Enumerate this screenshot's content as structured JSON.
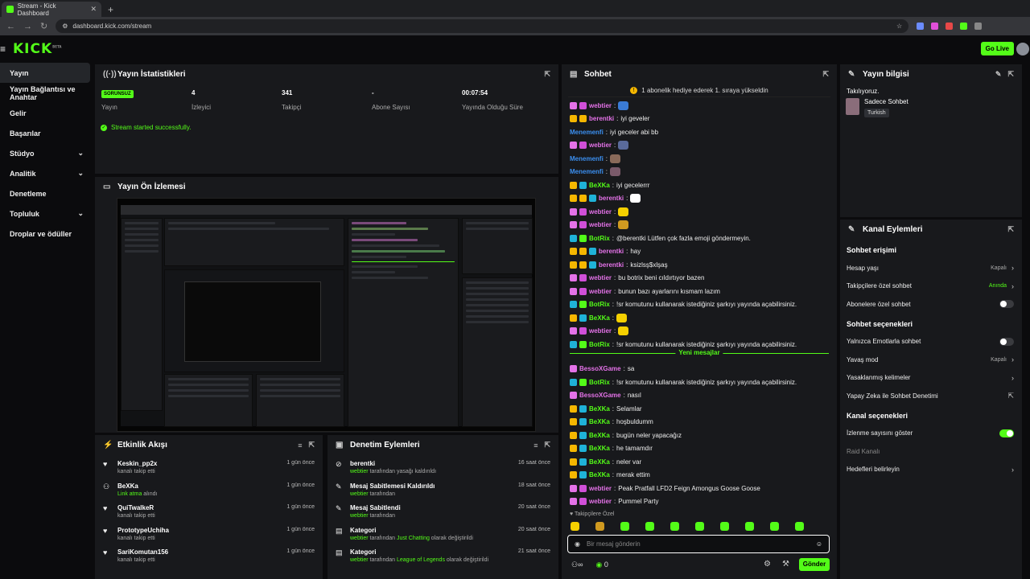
{
  "browser": {
    "tab_title": "Stream - Kick Dashboard",
    "tab_close": "✕",
    "new_tab": "+",
    "url": "dashboard.kick.com/stream"
  },
  "app": {
    "logo": "KICK",
    "logo_sup": "BETA",
    "go_live": "Go Live"
  },
  "sidebar": {
    "items": [
      {
        "label": "Yayın",
        "chevron": ""
      },
      {
        "label": "Yayın Bağlantısı ve Anahtar",
        "chevron": ""
      },
      {
        "label": "Gelir",
        "chevron": ""
      },
      {
        "label": "Başarılar",
        "chevron": ""
      },
      {
        "label": "Stüdyo",
        "chevron": "⌄"
      },
      {
        "label": "Analitik",
        "chevron": "⌄"
      },
      {
        "label": "Denetleme",
        "chevron": ""
      },
      {
        "label": "Topluluk",
        "chevron": "⌄"
      },
      {
        "label": "Droplar ve ödüller",
        "chevron": ""
      }
    ]
  },
  "stats_panel": {
    "title": "Yayın İstatistikleri",
    "items": [
      {
        "value": "SORUNSUZ",
        "label": "Yayın"
      },
      {
        "value": "4",
        "label": "İzleyici"
      },
      {
        "value": "341",
        "label": "Takipçi"
      },
      {
        "value": "-",
        "label": "Abone Sayısı"
      },
      {
        "value": "00:07:54",
        "label": "Yayında Olduğu Süre"
      }
    ],
    "success_msg": "Stream started successfully."
  },
  "preview_panel": {
    "title": "Yayın Ön İzlemesi"
  },
  "activity_panel": {
    "title": "Etkinlik Akışı",
    "items": [
      {
        "name": "Keskin_pp2x",
        "desc": "kanalı takip etti",
        "time": "1 gün önce",
        "icon": "♥"
      },
      {
        "name": "BeXKa",
        "desc": "Link atma",
        "desc2": " alındı",
        "time": "1 gün önce",
        "icon": "⚇"
      },
      {
        "name": "QuiTwalkeR",
        "desc": "kanalı takip etti",
        "time": "1 gün önce",
        "icon": "♥"
      },
      {
        "name": "PrototypeUchiha",
        "desc": "kanalı takip etti",
        "time": "1 gün önce",
        "icon": "♥"
      },
      {
        "name": "SariKomutan156",
        "desc": "kanalı takip etti",
        "time": "1 gün önce",
        "icon": "♥"
      }
    ]
  },
  "moderation_panel": {
    "title": "Denetim Eylemleri",
    "items": [
      {
        "title": "berentki",
        "actor": "webtier",
        "desc": " tarafından yasağı kaldırıldı",
        "time": "16 saat önce",
        "icon": "⊘"
      },
      {
        "title": "Mesaj Sabitlemesi Kaldırıldı",
        "actor": "webtier",
        "desc": " tarafından",
        "time": "18 saat önce",
        "icon": "✎"
      },
      {
        "title": "Mesaj Sabitlendi",
        "actor": "webtier",
        "desc": " tarafından",
        "time": "20 saat önce",
        "icon": "✎"
      },
      {
        "title": "Kategori",
        "actor": "webtier",
        "desc": " tarafından ",
        "hl": "Just Chatting",
        "desc3": " olarak değiştirildi",
        "time": "20 saat önce",
        "icon": "▤"
      },
      {
        "title": "Kategori",
        "actor": "webtier",
        "desc": " tarafından ",
        "hl": "League of Legends",
        "desc3": " olarak değiştirildi",
        "time": "21 saat önce",
        "icon": "▤"
      }
    ]
  },
  "chat_panel": {
    "title": "Sohbet",
    "pinned": "1 abonelik hediye ederek 1. sıraya yükseldin",
    "messages": [
      {
        "user": "webtier",
        "color": "#e472e8",
        "text": "",
        "emote": "#3a7bd5",
        "badges": [
          "#e472e8",
          "#d04fd8"
        ]
      },
      {
        "user": "berentki",
        "color": "#e472e8",
        "text": "iyi geveler",
        "badges": [
          "#f5b700",
          "#f5b700"
        ]
      },
      {
        "user": "Menemenfi",
        "color": "#3b8ff0",
        "text": "iyi geceler abi bb",
        "badges": []
      },
      {
        "user": "webtier",
        "color": "#e472e8",
        "text": "",
        "emote": "#5a6a9a",
        "badges": [
          "#e472e8",
          "#d04fd8"
        ]
      },
      {
        "user": "Menemenfi",
        "color": "#3b8ff0",
        "text": "",
        "emote": "#8a6a5a",
        "badges": []
      },
      {
        "user": "Menemenfi",
        "color": "#3b8ff0",
        "text": "",
        "emote": "#7a5a6a",
        "badges": []
      },
      {
        "user": "BeXKa",
        "color": "#53fc18",
        "text": "iyi gecelerrr",
        "badges": [
          "#f5b700",
          "#1fb2d8"
        ]
      },
      {
        "user": "berentki",
        "color": "#e472e8",
        "text": "",
        "emote": "#ffffff",
        "badges": [
          "#f5b700",
          "#f5b700",
          "#1fb2d8"
        ]
      },
      {
        "user": "webtier",
        "color": "#e472e8",
        "text": "",
        "emote": "#f5d000",
        "badges": [
          "#e472e8",
          "#d04fd8"
        ]
      },
      {
        "user": "webtier",
        "color": "#e472e8",
        "text": "",
        "emote": "#d09a20",
        "badges": [
          "#e472e8",
          "#d04fd8"
        ]
      },
      {
        "user": "BotRix",
        "color": "#53fc18",
        "text": "@berentki Lütfen çok fazla emoji göndermeyin.",
        "badges": [
          "#1fb2d8",
          "#53fc18"
        ]
      },
      {
        "user": "berentki",
        "color": "#e472e8",
        "text": "hay",
        "badges": [
          "#f5b700",
          "#f5b700",
          "#1fb2d8"
        ]
      },
      {
        "user": "berentki",
        "color": "#e472e8",
        "text": "ksizlsş$xlşaş",
        "badges": [
          "#f5b700",
          "#f5b700",
          "#1fb2d8"
        ]
      },
      {
        "user": "webtier",
        "color": "#e472e8",
        "text": "bu botrix beni cıldırtıyor bazen",
        "badges": [
          "#e472e8",
          "#d04fd8"
        ]
      },
      {
        "user": "webtier",
        "color": "#e472e8",
        "text": "bunun bazı ayarlarını kısmam lazım",
        "badges": [
          "#e472e8",
          "#d04fd8"
        ]
      },
      {
        "user": "BotRix",
        "color": "#53fc18",
        "text": "!sr komutunu kullanarak istediğiniz şarkıyı yayında açabilirsiniz.",
        "badges": [
          "#1fb2d8",
          "#53fc18"
        ]
      },
      {
        "user": "BeXKa",
        "color": "#53fc18",
        "text": "",
        "emote": "#f5d000",
        "badges": [
          "#f5b700",
          "#1fb2d8"
        ]
      },
      {
        "user": "webtier",
        "color": "#e472e8",
        "text": "",
        "emote": "#f5d000",
        "badges": [
          "#e472e8",
          "#d04fd8"
        ]
      },
      {
        "user": "BotRix",
        "color": "#53fc18",
        "text": "!sr komutunu kullanarak istediğiniz şarkıyı yayında açabilirsiniz.",
        "badges": [
          "#1fb2d8",
          "#53fc18"
        ]
      }
    ],
    "new_messages_label": "Yeni mesajlar",
    "new_messages": [
      {
        "user": "BessoXGame",
        "color": "#e472e8",
        "text": "sa",
        "badges": [
          "#e472e8"
        ]
      },
      {
        "user": "BotRix",
        "color": "#53fc18",
        "text": "!sr komutunu kullanarak istediğiniz şarkıyı yayında açabilirsiniz.",
        "badges": [
          "#1fb2d8",
          "#53fc18"
        ]
      },
      {
        "user": "BessoXGame",
        "color": "#e472e8",
        "text": "nasıl",
        "badges": [
          "#e472e8"
        ]
      },
      {
        "user": "BeXKa",
        "color": "#53fc18",
        "text": "Selamlar",
        "badges": [
          "#f5b700",
          "#1fb2d8"
        ]
      },
      {
        "user": "BeXKa",
        "color": "#53fc18",
        "text": "hoşbuldumm",
        "badges": [
          "#f5b700",
          "#1fb2d8"
        ]
      },
      {
        "user": "BeXKa",
        "color": "#53fc18",
        "text": "bugün neler yapacağız",
        "badges": [
          "#f5b700",
          "#1fb2d8"
        ]
      },
      {
        "user": "BeXKa",
        "color": "#53fc18",
        "text": "he tamamdır",
        "badges": [
          "#f5b700",
          "#1fb2d8"
        ]
      },
      {
        "user": "BeXKa",
        "color": "#53fc18",
        "text": "neler var",
        "badges": [
          "#f5b700",
          "#1fb2d8"
        ]
      },
      {
        "user": "BeXKa",
        "color": "#53fc18",
        "text": "merak ettim",
        "badges": [
          "#f5b700",
          "#1fb2d8"
        ]
      },
      {
        "user": "webtier",
        "color": "#e472e8",
        "text": "Peak Pratfall LFD2 Feign Amongus Goose Goose",
        "badges": [
          "#e472e8",
          "#d04fd8"
        ]
      },
      {
        "user": "webtier",
        "color": "#e472e8",
        "text": "Pummel Party",
        "badges": [
          "#e472e8",
          "#d04fd8"
        ]
      }
    ],
    "followers_only": "Takipçilere Özel",
    "input_placeholder": "Bir mesaj gönderin",
    "count": "0",
    "send": "Gönder"
  },
  "info_panel": {
    "title": "Yayın bilgisi",
    "following": "Takılıyoruz.",
    "category": "Sadece Sohbet",
    "language": "Turkish"
  },
  "channel_panel": {
    "title": "Kanal Eylemleri",
    "section1": "Sohbet erişimi",
    "section2": "Sohbet seçenekleri",
    "section3": "Kanal seçenekleri",
    "rows1": [
      {
        "label": "Hesap yaşı",
        "value": "Kapalı",
        "type": "arrow"
      },
      {
        "label": "Takipçilere özel sohbet",
        "value": "Anında",
        "type": "arrow",
        "green": true
      },
      {
        "label": "Abonelere özel sohbet",
        "value": "",
        "type": "toggle"
      }
    ],
    "rows2": [
      {
        "label": "Yalnızca Emotlarla sohbet",
        "value": "",
        "type": "toggle"
      },
      {
        "label": "Yavaş mod",
        "value": "Kapalı",
        "type": "arrow"
      },
      {
        "label": "Yasaklanmış kelimeler",
        "value": "",
        "type": "arrow"
      },
      {
        "label": "Yapay Zeka ile Sohbet Denetimi",
        "value": "",
        "type": "ext"
      }
    ],
    "rows3": [
      {
        "label": "İzlenme sayısını göster",
        "value": "",
        "type": "toggle-on"
      },
      {
        "label": "Raid Kanalı",
        "value": "",
        "type": "none",
        "dim": true
      },
      {
        "label": "Hedefleri belirleyin",
        "value": "",
        "type": "arrow"
      }
    ]
  }
}
